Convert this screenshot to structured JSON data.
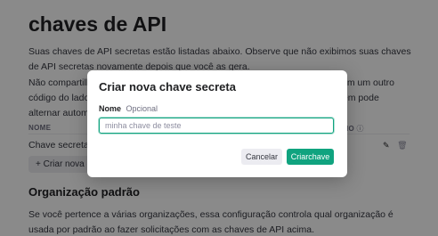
{
  "page": {
    "title": "chaves de API",
    "intro": "Suas chaves de API secretas estão listadas abaixo. Observe que não exibimos suas chaves de API secretas novamente depois que você as gera.",
    "warning_left": "Não compartilh",
    "warning_right": "em um outro",
    "warning_left2": "código do lado c",
    "warning_right2": "tém pode",
    "warning_left3": "alternar automa",
    "table": {
      "col_name": "NOME",
      "col_last": "IMO",
      "rows": [
        {
          "name": "Chave secreta"
        }
      ]
    },
    "create_button": "+ Criar nova cha",
    "org_section_title": "Organização padrão",
    "org_desc": "Se você pertence a várias organizações, essa configuração controla qual organização é usada por padrão ao fazer solicitações com as chaves de API acima."
  },
  "modal": {
    "title": "Criar nova chave secreta",
    "field_label": "Nome",
    "field_optional": "Opcional",
    "field_placeholder": "minha chave de teste",
    "cancel_label": "Cancelar",
    "create_label": "Criarchave"
  },
  "icons": {
    "edit": "pencil-icon",
    "delete": "trash-icon",
    "info": "info-icon"
  },
  "colors": {
    "accent": "#10a37f",
    "overlay": "rgba(0,0,0,0.46)"
  }
}
